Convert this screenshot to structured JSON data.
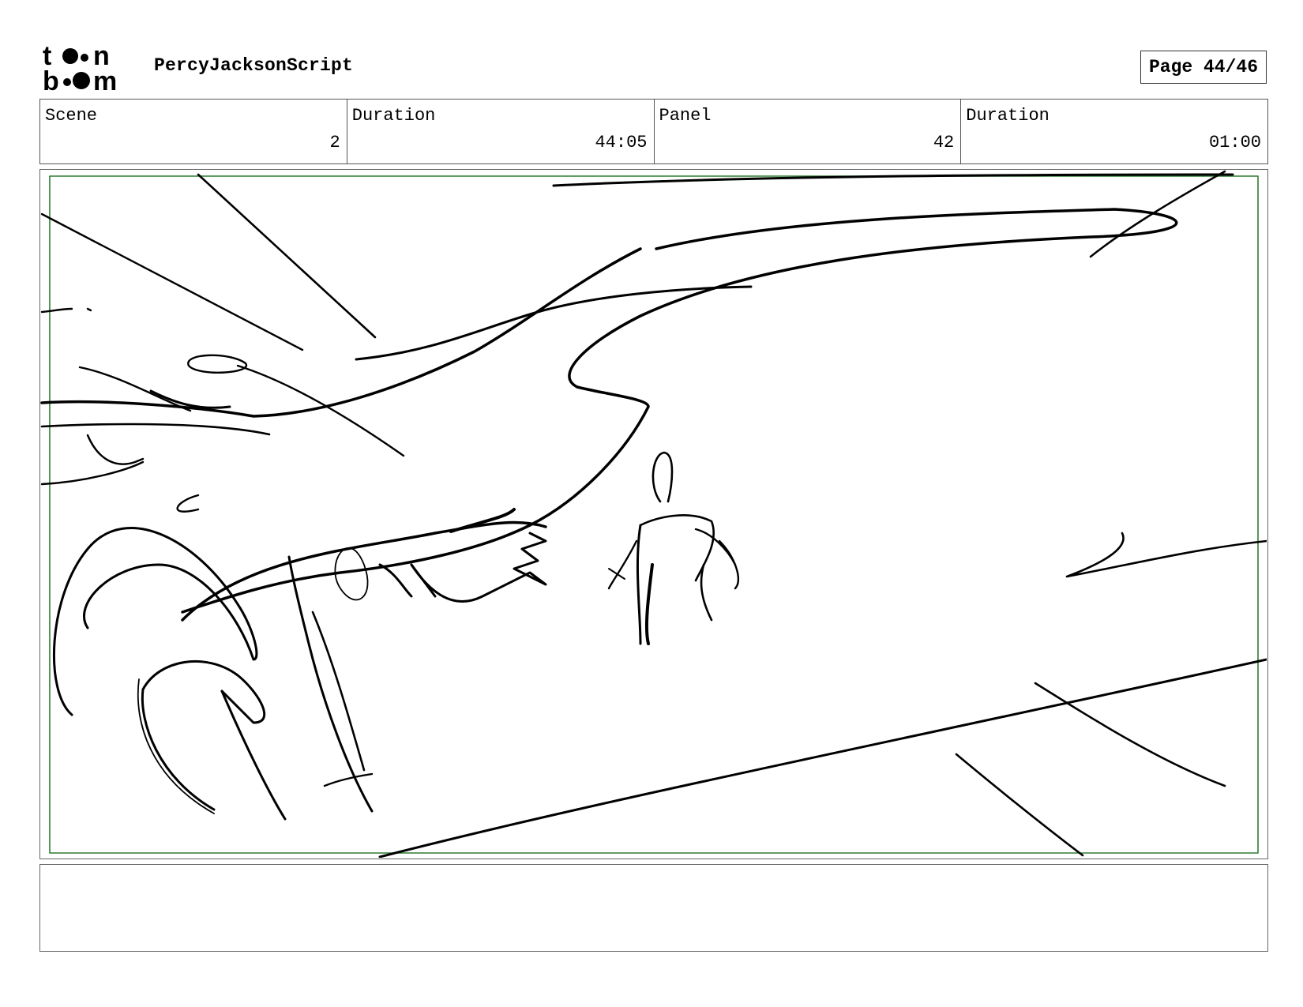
{
  "header": {
    "logo_text_top": "toon",
    "logo_text_bottom": "boom",
    "script_title": "PercyJacksonScript",
    "page_label": "Page 44/46"
  },
  "info": {
    "scene_label": "Scene",
    "scene_value": "2",
    "scene_duration_label": "Duration",
    "scene_duration_value": "44:05",
    "panel_label": "Panel",
    "panel_value": "42",
    "panel_duration_label": "Duration",
    "panel_duration_value": "01:00"
  },
  "panel": {
    "safe_frame_color": "#2e7d32",
    "sketch_color": "#000000"
  },
  "notes": {
    "text": ""
  }
}
